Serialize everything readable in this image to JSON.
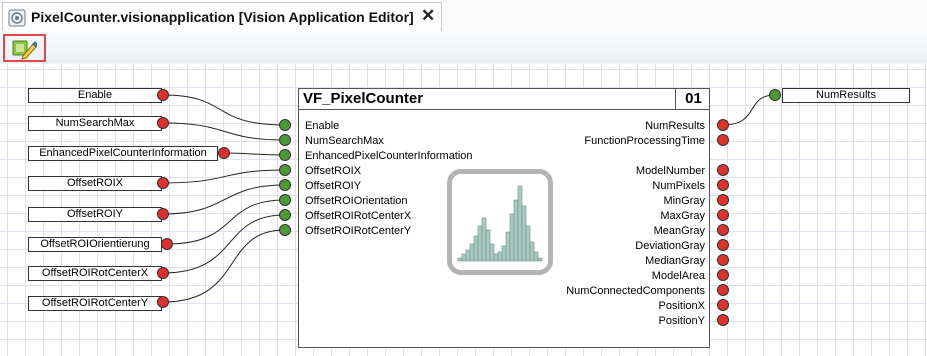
{
  "tab": {
    "title": "PixelCounter.visionapplication [Vision Application Editor]",
    "close_label": "✕"
  },
  "toolbar": {
    "run_tooltip": ""
  },
  "inputs": [
    "Enable",
    "NumSearchMax",
    "EnhancedPixelCounterInformation",
    "OffsetROIX",
    "OffsetROIY",
    "OffsetROIOrientierung",
    "OffsetROIRotCenterX",
    "OffsetROIRotCenterY"
  ],
  "output_variables": [
    "NumResults"
  ],
  "block": {
    "title": "VF_PixelCounter",
    "number": "01",
    "input_pins": [
      "Enable",
      "NumSearchMax",
      "EnhancedPixelCounterInformation",
      "OffsetROIX",
      "OffsetROIY",
      "OffsetROIOrientation",
      "OffsetROIRotCenterX",
      "OffsetROIRotCenterY"
    ],
    "output_pins_top": [
      "NumResults",
      "FunctionProcessingTime"
    ],
    "output_pins": [
      "ModelNumber",
      "NumPixels",
      "MinGray",
      "MaxGray",
      "MeanGray",
      "DeviationGray",
      "MedianGray",
      "ModelArea",
      "NumConnectedComponents",
      "PositionX",
      "PositionY"
    ],
    "histogram_icon": "histogram-icon"
  },
  "colors": {
    "connector_unconnected": "#e0302b",
    "connector_connected": "#4b9a36",
    "highlight": "#e0494b",
    "histogram_bar": "#a9c9c1"
  }
}
